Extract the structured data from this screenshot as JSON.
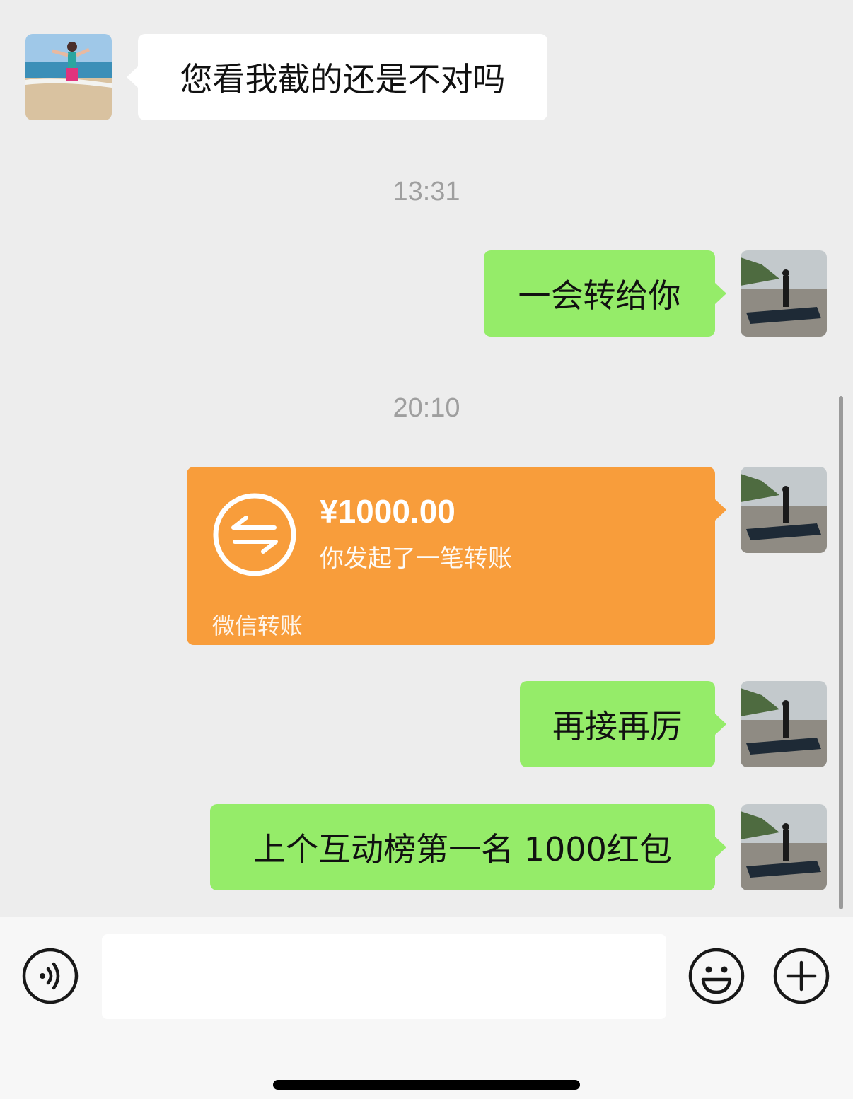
{
  "messages": {
    "m1": {
      "text": "您看我截的还是不对吗",
      "sender": "other"
    },
    "t1": "13:31",
    "m2": {
      "text": "一会转给你",
      "sender": "me"
    },
    "t2": "20:10",
    "transfer": {
      "amount": "¥1000.00",
      "description": "你发起了一笔转账",
      "footer": "微信转账",
      "icon": "transfer-arrows-icon",
      "color": "#f89d3b"
    },
    "m3": {
      "text": "再接再厉",
      "sender": "me"
    },
    "m4": {
      "text": "上个互动榜第一名 1000红包",
      "sender": "me"
    }
  },
  "input_bar": {
    "voice_icon": "voice-icon",
    "emoji_icon": "emoji-icon",
    "plus_icon": "plus-icon",
    "input_value": ""
  },
  "colors": {
    "background": "#ededed",
    "outgoing_bubble": "#95ec69",
    "incoming_bubble": "#ffffff"
  }
}
